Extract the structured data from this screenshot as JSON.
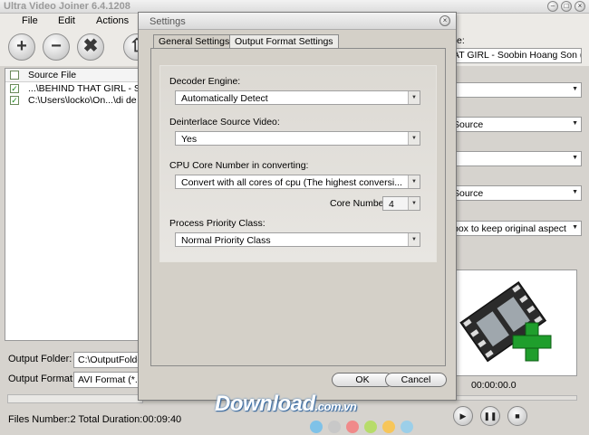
{
  "app": {
    "title": "Ultra Video Joiner 6.4.1208"
  },
  "menu": [
    "File",
    "Edit",
    "Actions"
  ],
  "toolbar": {
    "add": "+",
    "remove": "−",
    "clear": "✖",
    "up": "⇧"
  },
  "filelist": {
    "header": "Source File",
    "rows": [
      {
        "text": "...\\BEHIND THAT GIRL - Soobin"
      },
      {
        "text": "C:\\Users\\locko\\On...\\di de tro v"
      }
    ]
  },
  "bottom": {
    "output_folder_label": "Output Folder:",
    "output_folder_value": "C:\\OutputFolder",
    "output_format_label": "Output Format:",
    "output_format_value": "AVI Format (*.a",
    "status": "Files Number:2  Total Duration:00:09:40"
  },
  "right": {
    "title_label_suffix": "e:",
    "title_value": "AT GIRL - Soobin Hoang Son (OFFI",
    "dropdowns": [
      "",
      "Source",
      "",
      "Source",
      "box to keep original aspect"
    ],
    "timecode": "00:00:00.0"
  },
  "dialog": {
    "title": "Settings",
    "tabs": [
      "General Settings",
      "Output Format Settings"
    ],
    "decoder_label": "Decoder Engine:",
    "decoder_value": "Automatically Detect",
    "deinterlace_label": "Deinterlace Source Video:",
    "deinterlace_value": "Yes",
    "cpu_label": "CPU Core Number in converting:",
    "cpu_value": "Convert with all cores of cpu (The highest conversi...",
    "core_number_label": "Core Number:",
    "core_number_value": "4",
    "priority_label": "Process Priority Class:",
    "priority_value": "Normal Priority Class",
    "ok": "OK",
    "cancel": "Cancel"
  },
  "watermark": {
    "text": "Download",
    "suffix": ".com.vn"
  },
  "colors": {
    "dialog_bg": "#d4d0c8",
    "window_bg": "#d6d3ce",
    "accent_green": "#1f9e2c"
  }
}
